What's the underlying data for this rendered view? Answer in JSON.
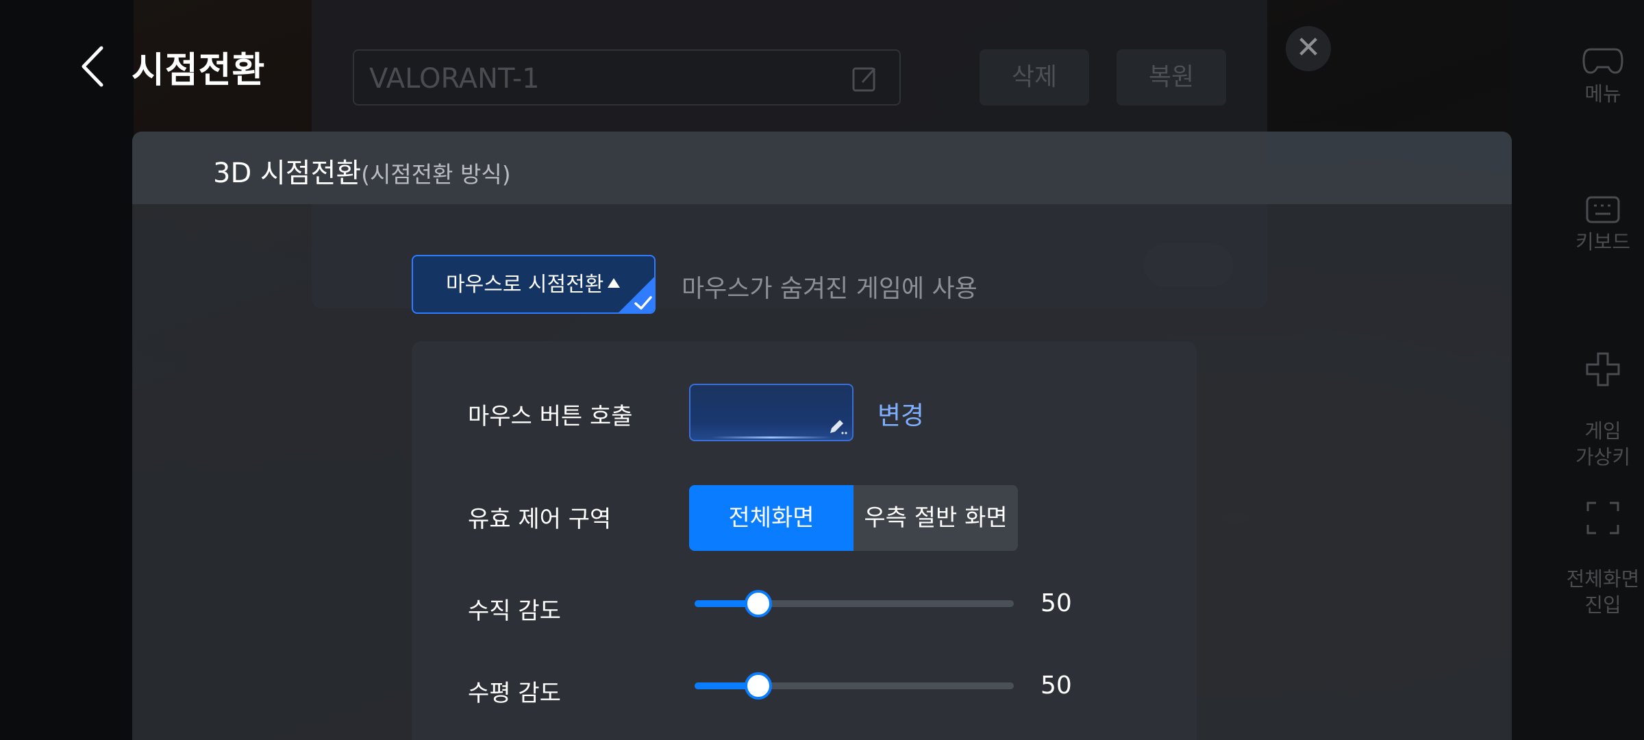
{
  "background": {
    "dialog": {
      "name_value": "VALORANT-1",
      "delete_label": "삭제",
      "restore_label": "복원",
      "close_symbol": "✕"
    },
    "right_bar": [
      {
        "label": "메뉴",
        "icon": "gamepad-icon"
      },
      {
        "label": "키보드",
        "icon": "keyboard-icon"
      },
      {
        "label": "게임\n가상키",
        "icon": "dpad-icon"
      },
      {
        "label": "전체화면\n진입",
        "icon": "fullscreen-icon"
      }
    ]
  },
  "header": {
    "title": "시점전환"
  },
  "panel": {
    "title": "3D 시점전환",
    "subtitle": "(시점전환 방식)",
    "mode": {
      "selected": "마우스로 시점전환",
      "description": "마우스가 숨겨진 게임에 사용"
    },
    "settings": {
      "mouse_button": {
        "label": "마우스 버튼 호출",
        "value": "",
        "change_label": "변경"
      },
      "area": {
        "label": "유효 제어 구역",
        "options": [
          "전체화면",
          "우측 절반 화면만"
        ],
        "selected_index": 0
      },
      "vertical": {
        "label": "수직 감도",
        "value": 50,
        "value_text": "50",
        "fraction": 0.2
      },
      "horizontal": {
        "label": "수평 감도",
        "value": 50,
        "value_text": "50",
        "fraction": 0.2
      }
    }
  },
  "colors": {
    "accent": "#0a7cff",
    "link": "#7fb0ff"
  }
}
